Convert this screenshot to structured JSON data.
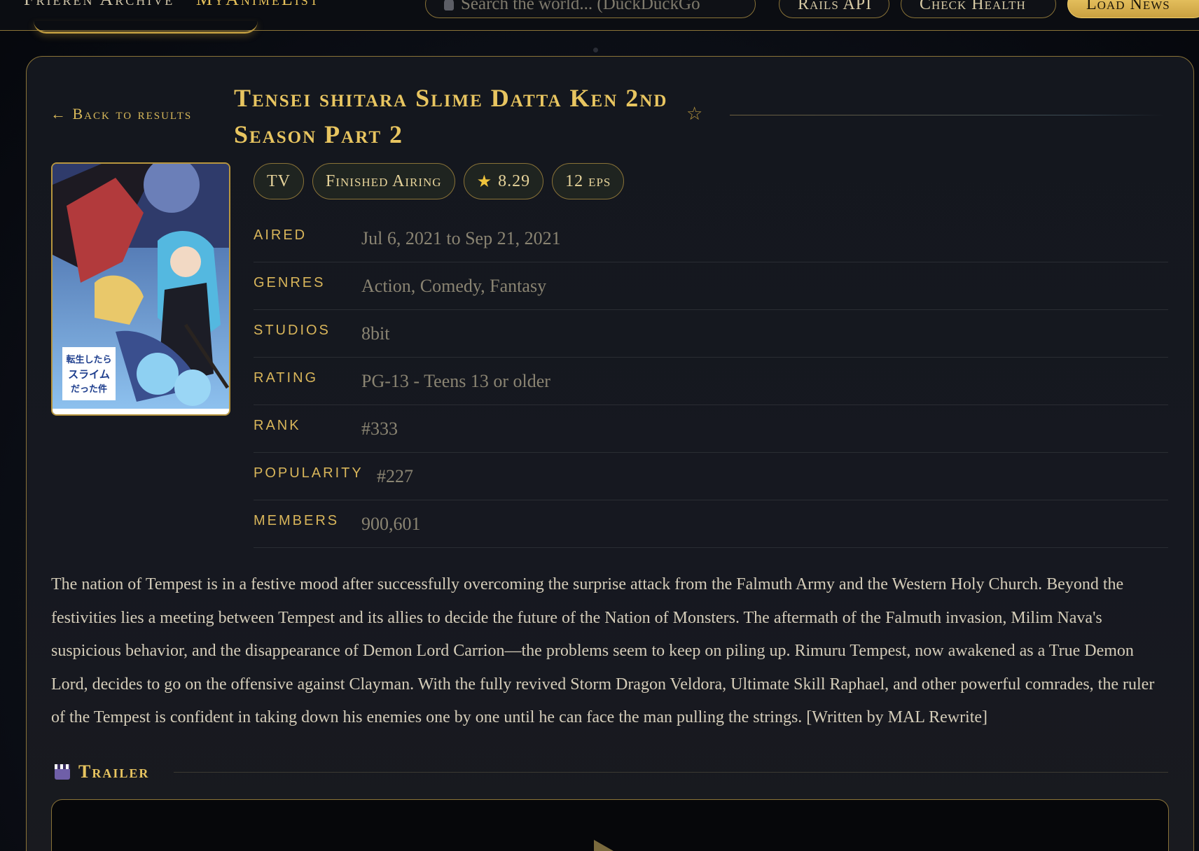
{
  "topbar": {
    "brand_prefix": "Frieren Archive · ",
    "brand_accent": "MyAnimeList",
    "search_placeholder": "Search the world... (DuckDuckGo",
    "buttons": [
      "Rails API",
      "Check Health",
      "Load News"
    ]
  },
  "detail": {
    "back_label": "← Back to results",
    "title": "Tensei shitara Slime Datta Ken 2nd Season Part 2",
    "favorite_icon": "star-outline-icon",
    "badges": {
      "type": "TV",
      "status": "Finished Airing",
      "score": "8.29",
      "episodes": "12 eps"
    },
    "info": [
      {
        "label": "Aired",
        "value": "Jul 6, 2021 to Sep 21, 2021"
      },
      {
        "label": "Genres",
        "value": "Action, Comedy, Fantasy"
      },
      {
        "label": "Studios",
        "value": "8bit"
      },
      {
        "label": "Rating",
        "value": "PG-13 - Teens 13 or older"
      },
      {
        "label": "Rank",
        "value": "#333"
      },
      {
        "label": "Popularity",
        "value": "#227"
      },
      {
        "label": "Members",
        "value": "900,601"
      }
    ],
    "synopsis": "The nation of Tempest is in a festive mood after successfully overcoming the surprise attack from the Falmuth Army and the Western Holy Church. Beyond the festivities lies a meeting between Tempest and its allies to decide the future of the Nation of Monsters. The aftermath of the Falmuth invasion, Milim Nava's suspicious behavior, and the disappearance of Demon Lord Carrion—the problems seem to keep on piling up. Rimuru Tempest, now awakened as a True Demon Lord, decides to go on the offensive against Clayman. With the fully revived Storm Dragon Veldora, Ultimate Skill Raphael, and other powerful comrades, the ruler of the Tempest is confident in taking down his enemies one by one until he can face the man pulling the strings. [Written by MAL Rewrite]",
    "trailer_label": "Trailer",
    "poster_logo_lines": [
      "転生したら",
      "スライム",
      "だった件"
    ]
  },
  "colors": {
    "gold": "#e8c560",
    "border": "#8a7338",
    "bg": "#0d1018"
  }
}
